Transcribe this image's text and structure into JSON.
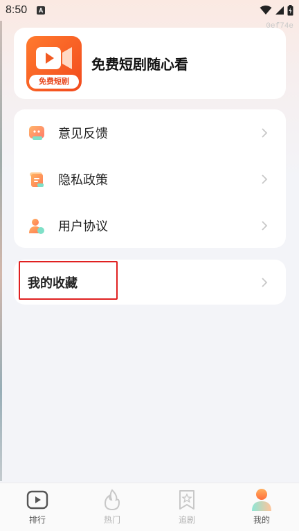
{
  "status_bar": {
    "time": "8:50",
    "notification_letter": "A"
  },
  "version_tag": "0ef74e",
  "header": {
    "app_name": "免费短剧随心看",
    "logo_badge": "免费短剧"
  },
  "menu": {
    "items": [
      {
        "label": "意见反馈",
        "icon": "feedback-icon"
      },
      {
        "label": "隐私政策",
        "icon": "privacy-policy-icon"
      },
      {
        "label": "用户协议",
        "icon": "user-agreement-icon"
      }
    ]
  },
  "favorites": {
    "label": "我的收藏"
  },
  "tabs": [
    {
      "label": "排行",
      "icon": "play-ranking-icon"
    },
    {
      "label": "热门",
      "icon": "flame-icon"
    },
    {
      "label": "追剧",
      "icon": "bookmark-star-icon"
    },
    {
      "label": "我的",
      "icon": "profile-icon",
      "active": true
    }
  ],
  "colors": {
    "brand_orange": "#f25a22",
    "highlight_red": "#e02020",
    "background": "#f3f4f8"
  }
}
